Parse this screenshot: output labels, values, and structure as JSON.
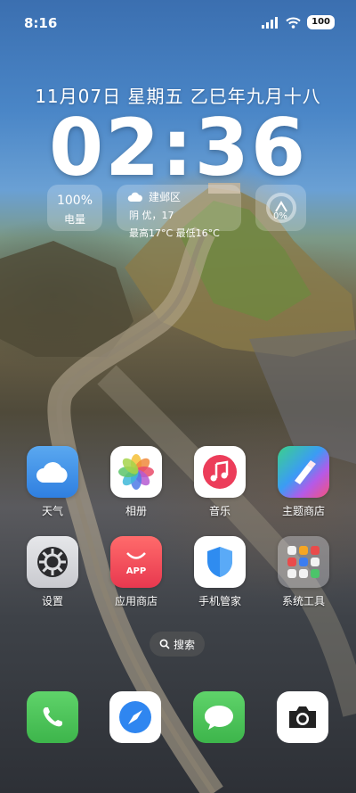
{
  "status": {
    "time": "8:16",
    "battery": "100"
  },
  "lockscreen": {
    "date": "11月07日 星期五 乙巳年九月十八",
    "clock": "02:36"
  },
  "widgets": {
    "battery": {
      "percent": "100%",
      "label": "电量"
    },
    "weather": {
      "location": "建邺区",
      "condition": "阴 优，17",
      "high_low": "最高17°C 最低16°C"
    },
    "ring": {
      "percent": "0%"
    }
  },
  "apps": [
    {
      "label": "天气",
      "icon": "cloud-icon"
    },
    {
      "label": "相册",
      "icon": "photos-flower-icon"
    },
    {
      "label": "音乐",
      "icon": "music-note-icon"
    },
    {
      "label": "主题商店",
      "icon": "paintbrush-icon"
    },
    {
      "label": "设置",
      "icon": "gear-icon"
    },
    {
      "label": "应用商店",
      "icon": "shopping-bag-icon",
      "badge": "APP"
    },
    {
      "label": "手机管家",
      "icon": "shield-icon"
    },
    {
      "label": "系统工具",
      "icon": "folder-grid-icon"
    }
  ],
  "search": {
    "label": "搜索"
  },
  "dock": [
    {
      "name": "phone",
      "icon": "phone-icon"
    },
    {
      "name": "browser",
      "icon": "compass-icon"
    },
    {
      "name": "messages",
      "icon": "message-bubble-icon"
    },
    {
      "name": "camera",
      "icon": "camera-icon"
    }
  ]
}
